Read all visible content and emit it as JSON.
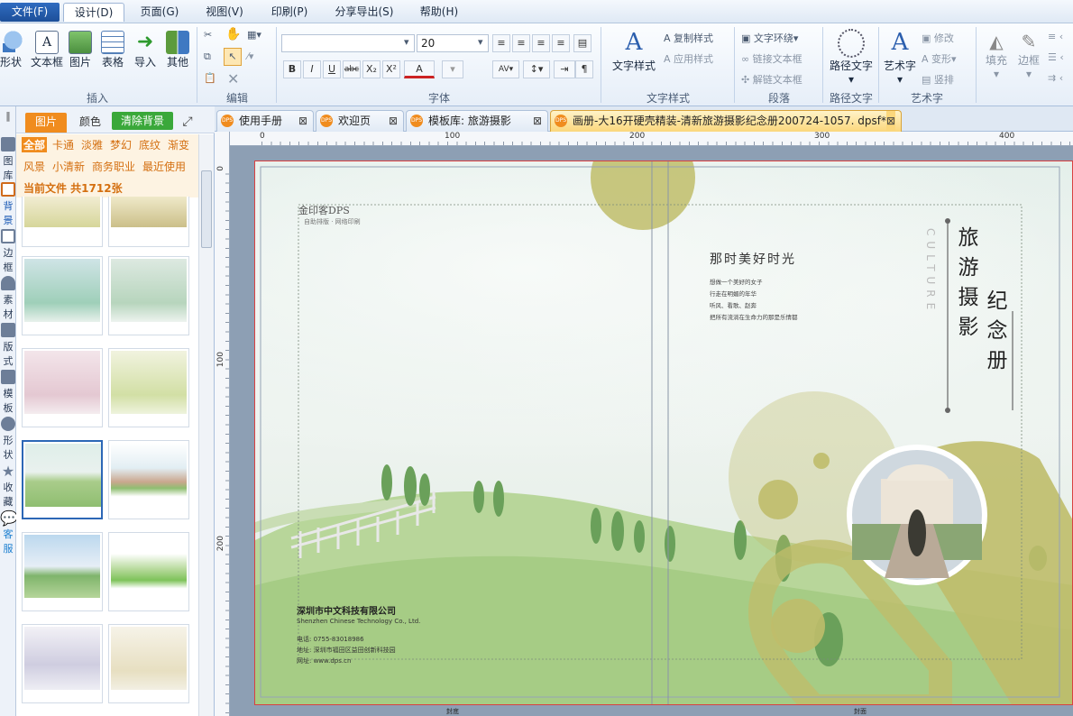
{
  "menu": {
    "items": [
      "文件(F)",
      "设计(D)",
      "页面(G)",
      "视图(V)",
      "印刷(P)",
      "分享导出(S)",
      "帮助(H)"
    ],
    "active": "设计(D)"
  },
  "ribbon": {
    "insert": {
      "group_label": "插入",
      "buttons": [
        "形状",
        "文本框",
        "图片",
        "表格",
        "导入",
        "其他"
      ]
    },
    "edit": {
      "group_label": "编辑"
    },
    "font": {
      "group_label": "字体",
      "font_name": "",
      "font_size": "20",
      "format_buttons": [
        "B",
        "I",
        "U",
        "abc",
        "X₂",
        "X²",
        "A"
      ]
    },
    "text_style": {
      "group_label": "文字样式",
      "main_label": "文字样式",
      "copy_label": "复制样式",
      "apply_label": "应用样式"
    },
    "paragraph": {
      "group_label": "段落",
      "wrap_label": "文字环绕",
      "link_label": "链接文本框",
      "unlink_label": "解链文本框"
    },
    "path_text": {
      "group_label": "路径文字",
      "main_label": "路径文字"
    },
    "art_text": {
      "group_label": "艺术字",
      "main_label": "艺术字",
      "modify_label": "修改",
      "transform_label": "变形",
      "vertical_label": "竖排"
    },
    "fill": {
      "fill_label": "填充",
      "border_label": "边框"
    }
  },
  "leftstrip": {
    "items": [
      "图库",
      "背景",
      "边框",
      "素材",
      "版式",
      "模板",
      "形状",
      "收藏",
      "客服"
    ]
  },
  "sidepanel": {
    "tabs": [
      "图片",
      "颜色"
    ],
    "clear_bg_label": "清除背景",
    "filters_row1": [
      "全部",
      "卡通",
      "淡雅",
      "梦幻",
      "底纹",
      "渐变"
    ],
    "filters_row2": [
      "风景",
      "小清新",
      "商务职业",
      "最近使用"
    ],
    "count_text": "当前文件  共1712张"
  },
  "doctabs": [
    {
      "label": "使用手册",
      "active": false
    },
    {
      "label": "欢迎页",
      "active": false
    },
    {
      "label": "模板库: 旅游摄影",
      "active": false
    },
    {
      "label": "画册-大16开硬壳精装-清新旅游摄影纪念册200724-1057. dpsf*",
      "active": true
    }
  ],
  "rulers": {
    "h_labels": [
      "0",
      "100",
      "200",
      "300",
      "400"
    ],
    "v_labels": [
      "0",
      "100",
      "200"
    ]
  },
  "document": {
    "logo_text": "金印客DPS",
    "logo_sub": "自助排版 · 网络印刷",
    "poem_title": "那时美好时光",
    "poem_lines": [
      "想做一个美好的女子",
      "行走在明媚的年华",
      "听风、看歌、赵奔",
      "把所有流淌在生命力的那是乐情都"
    ],
    "culture_text": "CULTURE",
    "title_col1": "旅游摄影",
    "title_col2": "纪念册",
    "company_cn": "深圳市中文科技有限公司",
    "company_en": "Shenzhen Chinese Technology Co., Ltd.",
    "contact_phone": "电话: 0755-83018986",
    "contact_address": "地址: 深圳市福田区益田创新科技园",
    "contact_web": "网址: www.dps.cn",
    "back_cover_label": "封底",
    "front_cover_label": "封面"
  },
  "colors": {
    "accent_olive": "#bfbd6a",
    "page_border": "#d94040",
    "canvas_bg": "#8d9fb4",
    "filter_orange": "#d46f10",
    "clear_bg_green": "#3aa83a"
  }
}
